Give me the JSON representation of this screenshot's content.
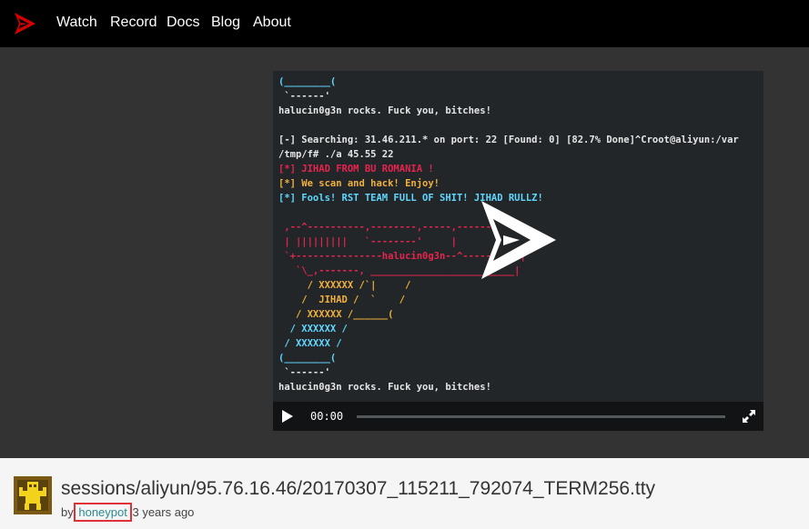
{
  "nav": {
    "items": [
      {
        "label": "Watch"
      },
      {
        "label": "Record"
      },
      {
        "label": "Docs"
      },
      {
        "label": "Blog"
      },
      {
        "label": "About"
      }
    ]
  },
  "terminal": {
    "lines": [
      {
        "text": "(________(",
        "color": "cyan"
      },
      {
        "text": " `------'",
        "color": "white"
      },
      {
        "text": "halucin0g3n rocks. Fuck you, bitches!",
        "color": "white"
      },
      {
        "text": "",
        "color": "white"
      },
      {
        "text": "[-] Searching: 31.46.211.* on port: 22 [Found: 0] [82.7% Done]^Croot@aliyun:/var",
        "color": "white"
      },
      {
        "text": "/tmp/f# ./a 45.55 22",
        "color": "white"
      },
      {
        "text": "[*] JIHAD FROM BU ROMANIA !",
        "color": "red"
      },
      {
        "text": "[*] We scan and hack! Enjoy!",
        "color": "yellow"
      },
      {
        "text": "[*] Fools! RST TEAM FULL OF SHIT! JIHAD RULLZ!",
        "color": "cyan"
      },
      {
        "text": "",
        "color": "white"
      },
      {
        "text": " ,--^----------,--------,-----,--------^-,",
        "color": "red"
      },
      {
        "text": " | |||||||||   `--------'     |          O",
        "color": "red"
      },
      {
        "text": " `+---------------halucin0g3n--^----------|",
        "color": "red"
      },
      {
        "text": "   `\\_,-------, _________________________|",
        "color": "red"
      },
      {
        "text": "     / XXXXXX /`|     /",
        "color": "yellow"
      },
      {
        "text": "    /  JIHAD /  `    /",
        "color": "yellow"
      },
      {
        "text": "   / XXXXXX /______(",
        "color": "yellow"
      },
      {
        "text": "  / XXXXXX /",
        "color": "cyan"
      },
      {
        "text": " / XXXXXX /",
        "color": "cyan"
      },
      {
        "text": "(________(",
        "color": "cyan"
      },
      {
        "text": " `------'",
        "color": "white"
      },
      {
        "text": "halucin0g3n rocks. Fuck you, bitches!",
        "color": "white"
      }
    ]
  },
  "player": {
    "time": "00:00",
    "progress": 0.0
  },
  "recording": {
    "title": "sessions/aliyun/95.76.16.46/20170307_115211_792074_TERM256.tty",
    "by_label": "by",
    "author": "honeypot",
    "age": "3 years ago"
  },
  "colors": {
    "navbar_bg": "#000000",
    "stage_bg": "#333333",
    "terminal_bg": "#232628",
    "brand_red": "#d40000",
    "link": "#2a8c94",
    "highlight_box": "#e0303a"
  }
}
